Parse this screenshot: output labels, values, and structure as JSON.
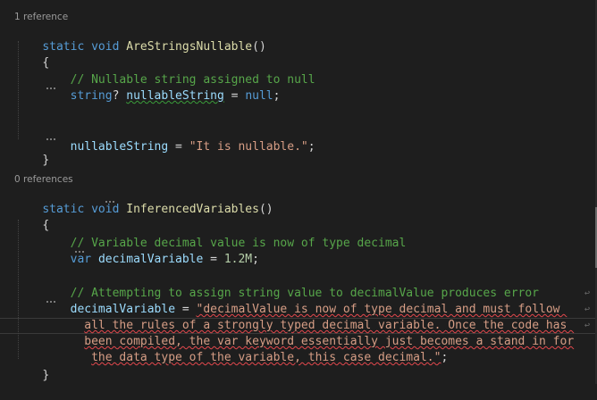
{
  "codelens": {
    "first": "1 reference",
    "second": "0 references"
  },
  "code": {
    "m1_static": "static",
    "m1_void": "void",
    "m1_name": "AreStringsNullable",
    "m1_parens": "()",
    "brace_open": "{",
    "brace_close": "}",
    "c1": "// Nullable string assigned to null",
    "t_string": "string",
    "q": "?",
    "v_nullable": "nullableString",
    "eq": " = ",
    "kw_null": "null",
    "semi": ";",
    "assign_nullable_str": "\"It is nullable.\"",
    "m2_static": "static",
    "m2_void": "void",
    "m2_name": "InferencedVariables",
    "m2_parens": "()",
    "c2": "// Variable decimal value is now of type decimal",
    "kw_var": "var",
    "v_decimal": "decimalVariable",
    "num_12m": "1.2M",
    "c3": "// Attempting to assign string value to decimalValue produces error",
    "str1": "\"decimalValue is now of type decimal and must follow ",
    "str2": "all the rules of a strongly typed decimal variable. Once the code has ",
    "str3": "been compiled, the var keyword essentially just becomes a stand in for",
    "str4": "the data type of the variable, this case decimal.\""
  },
  "icons": {
    "wrap": "word-wrap-icon"
  },
  "colors": {
    "background": "#1e1e1e",
    "keyword": "#569cd6",
    "method": "#dcdcaa",
    "comment": "#57a64a",
    "variable": "#9cdcfe",
    "string": "#d69d85",
    "number": "#b5cea8",
    "error": "#e5484d"
  }
}
